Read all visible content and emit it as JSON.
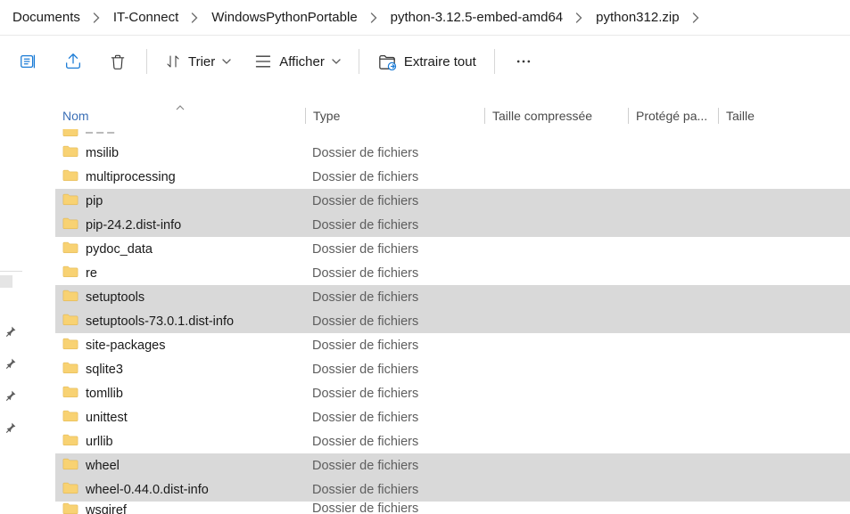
{
  "breadcrumb": [
    "Documents",
    "IT-Connect",
    "WindowsPythonPortable",
    "python-3.12.5-embed-amd64",
    "python312.zip"
  ],
  "toolbar": {
    "sort": "Trier",
    "view": "Afficher",
    "extract": "Extraire tout"
  },
  "columns": {
    "name": "Nom",
    "type": "Type",
    "compressed": "Taille compressée",
    "protected": "Protégé pa...",
    "size": "Taille"
  },
  "type_folder": "Dossier de fichiers",
  "files": [
    {
      "name": "msilib",
      "selected": false
    },
    {
      "name": "multiprocessing",
      "selected": false
    },
    {
      "name": "pip",
      "selected": true
    },
    {
      "name": "pip-24.2.dist-info",
      "selected": true
    },
    {
      "name": "pydoc_data",
      "selected": false
    },
    {
      "name": "re",
      "selected": false
    },
    {
      "name": "setuptools",
      "selected": true
    },
    {
      "name": "setuptools-73.0.1.dist-info",
      "selected": true
    },
    {
      "name": "site-packages",
      "selected": false
    },
    {
      "name": "sqlite3",
      "selected": false
    },
    {
      "name": "tomllib",
      "selected": false
    },
    {
      "name": "unittest",
      "selected": false
    },
    {
      "name": "urllib",
      "selected": false
    },
    {
      "name": "wheel",
      "selected": true
    },
    {
      "name": "wheel-0.44.0.dist-info",
      "selected": true
    },
    {
      "name": "wsgiref",
      "selected": false
    }
  ]
}
